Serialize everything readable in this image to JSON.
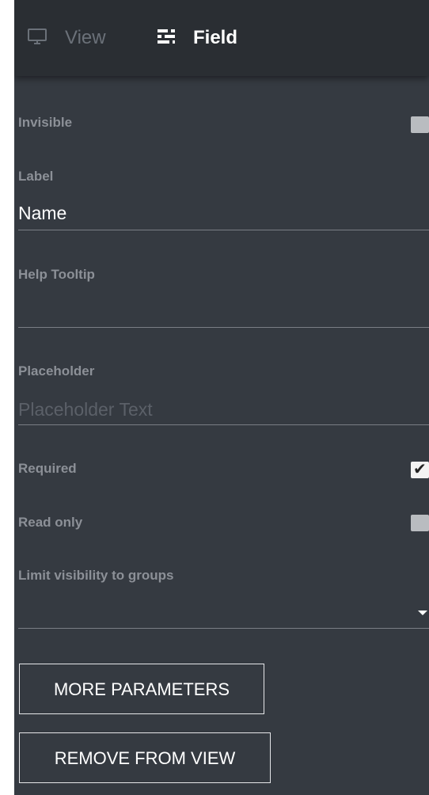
{
  "tabs": {
    "view": {
      "label": "View",
      "icon": "monitor-icon"
    },
    "field": {
      "label": "Field",
      "icon": "field-settings-icon"
    }
  },
  "form": {
    "invisible": {
      "label": "Invisible",
      "checked": false
    },
    "label": {
      "label": "Label",
      "value": "Name"
    },
    "help_tooltip": {
      "label": "Help Tooltip",
      "value": ""
    },
    "placeholder": {
      "label": "Placeholder",
      "placeholder": "Placeholder Text",
      "value": ""
    },
    "required": {
      "label": "Required",
      "checked": true
    },
    "read_only": {
      "label": "Read only",
      "checked": false
    },
    "limit_visibility": {
      "label": "Limit visibility to groups",
      "value": ""
    }
  },
  "buttons": {
    "more_parameters": "MORE PARAMETERS",
    "remove_from_view": "REMOVE FROM VIEW"
  },
  "colors": {
    "panel_background": "#353a41",
    "header_background": "#2a2e33",
    "label_text": "#8c9097",
    "active_text": "#ffffff",
    "inactive_tab_text": "#6b7179"
  }
}
